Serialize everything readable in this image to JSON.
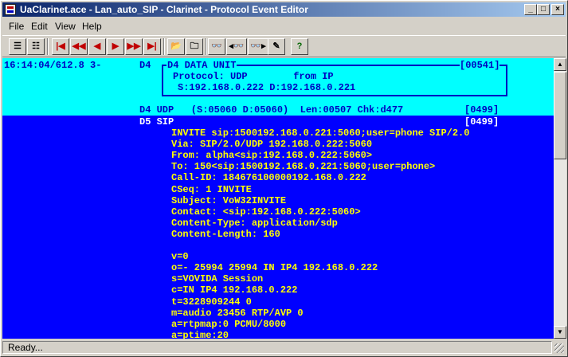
{
  "window": {
    "title": "UaClarinet.ace - Lan_auto_SIP - Clarinet - Protocol Event Editor",
    "minimize_glyph": "_",
    "maximize_glyph": "□",
    "close_glyph": "×"
  },
  "menu": [
    "File",
    "Edit",
    "View",
    "Help"
  ],
  "toolbar": {
    "buttons": [
      {
        "name": "view-list-icon",
        "glyph": "☰"
      },
      {
        "name": "view-detail-icon",
        "glyph": "☷"
      },
      {
        "name": "first-event-icon",
        "glyph": "|◀"
      },
      {
        "name": "fast-back-icon",
        "glyph": "◀◀"
      },
      {
        "name": "prev-icon",
        "glyph": "◀"
      },
      {
        "name": "next-icon",
        "glyph": "▶"
      },
      {
        "name": "fast-forward-icon",
        "glyph": "▶▶"
      },
      {
        "name": "last-event-icon",
        "glyph": "▶|"
      },
      {
        "name": "open-folder-icon",
        "glyph": "📂"
      },
      {
        "name": "open-file-icon",
        "glyph": "🗀"
      },
      {
        "name": "find-icon",
        "glyph": "👓"
      },
      {
        "name": "find-prev-icon",
        "glyph": "◂👓"
      },
      {
        "name": "find-next-icon",
        "glyph": "👓▸"
      },
      {
        "name": "edit-icon",
        "glyph": "✎"
      },
      {
        "name": "help-icon",
        "glyph": "?"
      }
    ]
  },
  "trace": {
    "timestamp": "16:14:04/612.8 3-",
    "d4_tag": "D4",
    "data_unit_header": "D4 DATA UNIT",
    "data_unit_index": "[00541]",
    "protocol_line": "Protocol: UDP        from IP",
    "address_line": "S:192.168.0.222 D:192.168.0.221",
    "udp_line": "D4 UDP   (S:05060 D:05060)  Len:00507 Chk:d477",
    "udp_index": "[0499]",
    "sip_line": "D5 SIP",
    "sip_index": "[0499]",
    "sip_lines": [
      "INVITE sip:1500192.168.0.221:5060;user=phone SIP/2.0",
      "Via: SIP/2.0/UDP 192.168.0.222:5060",
      "From: alpha<sip:192.168.0.222:5060>",
      "To: 150<sip:1500192.168.0.221:5060;user=phone>",
      "Call-ID: 184676100000192.168.0.222",
      "CSeq: 1 INVITE",
      "Subject: VoW32INVITE",
      "Contact: <sip:192.168.0.222:5060>",
      "Content-Type: application/sdp",
      "Content-Length: 160",
      "",
      "v=0",
      "o=- 25994 25994 IN IP4 192.168.0.222",
      "s=VOVIDA Session",
      "c=IN IP4 192.168.0.222",
      "t=3228909244 0",
      "m=audio 23456 RTP/AVP 0",
      "a=rtpmap:0 PCMU/8000",
      "a=ptime:20"
    ]
  },
  "status": {
    "text": "Ready..."
  },
  "scrollbar": {
    "up_glyph": "▲",
    "down_glyph": "▼"
  }
}
